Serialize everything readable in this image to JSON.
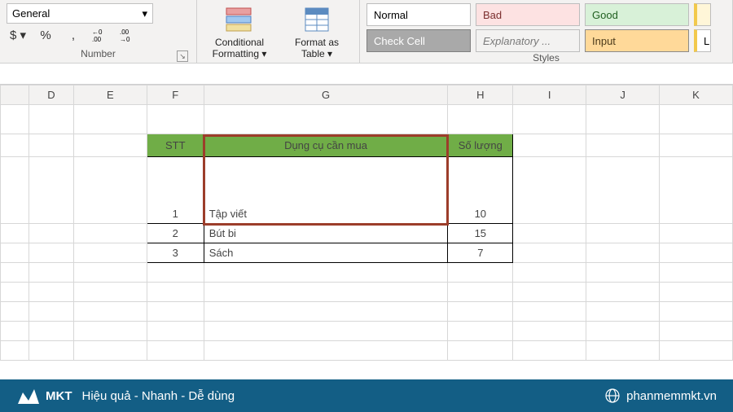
{
  "ribbon": {
    "number": {
      "format_selected": "General",
      "currency": "$",
      "percent": "%",
      "comma": ",",
      "inc_dec": "←0 .00",
      "dec_dec": ".00 →0",
      "group_label": "Number"
    },
    "cond_fmt": {
      "label1": "Conditional",
      "label2": "Formatting"
    },
    "fmt_table": {
      "label1": "Format as",
      "label2": "Table"
    },
    "styles": {
      "tiles": {
        "normal": "Normal",
        "bad": "Bad",
        "good": "Good",
        "check": "Check Cell",
        "explanatory": "Explanatory ...",
        "input": "Input",
        "partial": "L"
      },
      "group_label": "Styles"
    }
  },
  "columns": [
    "D",
    "E",
    "F",
    "G",
    "H",
    "I",
    "J",
    "K"
  ],
  "chart_data": {
    "type": "table",
    "title": "",
    "headers": [
      "STT",
      "Dụng cụ cần mua",
      "Số lượng"
    ],
    "rows": [
      {
        "stt": "1",
        "item": "Tập viết",
        "qty": "10"
      },
      {
        "stt": "2",
        "item": "Bút bi",
        "qty": "15"
      },
      {
        "stt": "3",
        "item": "Sách",
        "qty": "7"
      }
    ]
  },
  "footer": {
    "logo_text": "MKT",
    "slogan": "Hiệu quả - Nhanh - Dễ dùng",
    "site": "phanmemmkt.vn"
  }
}
